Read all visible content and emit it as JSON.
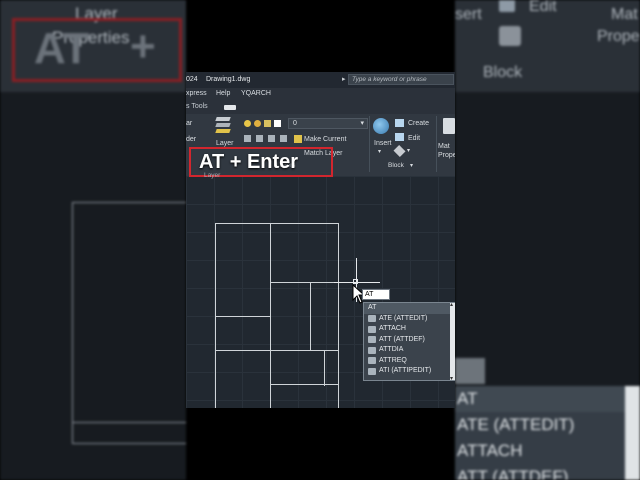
{
  "app": {
    "year_fragment": "024",
    "document_title": "Drawing1.dwg",
    "search_placeholder": "Type a keyword or phrase"
  },
  "menu": {
    "items": [
      "xpress",
      "Help",
      "YQARCH"
    ]
  },
  "tabs": {
    "tools_label": "s Tools"
  },
  "ribbon": {
    "layer_number": "0",
    "make_current": "Make Current",
    "match_layer": "Match Layer",
    "layer_label": "Layer",
    "layers_group": "Layers",
    "insert_label": "Insert",
    "create_label": "Create",
    "edit_label": "Edit",
    "block_group": "Block",
    "match_properties": "Mat Prope",
    "left_fragments": [
      "ar",
      "der"
    ]
  },
  "blur_left": {
    "layer_label": "Layer",
    "properties_label": "Properties",
    "at_text": "AT",
    "plus": "+"
  },
  "blur_right": {
    "insert": "sert",
    "edit": "Edit",
    "block": "Block",
    "mat": "Mat",
    "prope": "Prope",
    "list": [
      "AT",
      "ATE (ATTEDIT)",
      "ATTACH",
      "ATT (ATTDEF)"
    ]
  },
  "callout": {
    "text": "AT + Enter"
  },
  "command": {
    "typed": "AT"
  },
  "autocomplete": {
    "items": [
      {
        "label": "AT",
        "icon": ""
      },
      {
        "label": "ATE (ATTEDIT)",
        "icon": "attribute-edit-icon"
      },
      {
        "label": "ATTACH",
        "icon": "attach-icon"
      },
      {
        "label": "ATT (ATTDEF)",
        "icon": "attribute-define-icon"
      },
      {
        "label": "ATTDIA",
        "icon": "variable-icon"
      },
      {
        "label": "ATTREQ",
        "icon": "variable-icon"
      },
      {
        "label": "ATI (ATTIPEDIT)",
        "icon": "attribute-edit-icon"
      }
    ]
  },
  "colors": {
    "callout_border": "#d2262e",
    "drawing_lines": "#cfd4d8",
    "background": "#212830"
  }
}
